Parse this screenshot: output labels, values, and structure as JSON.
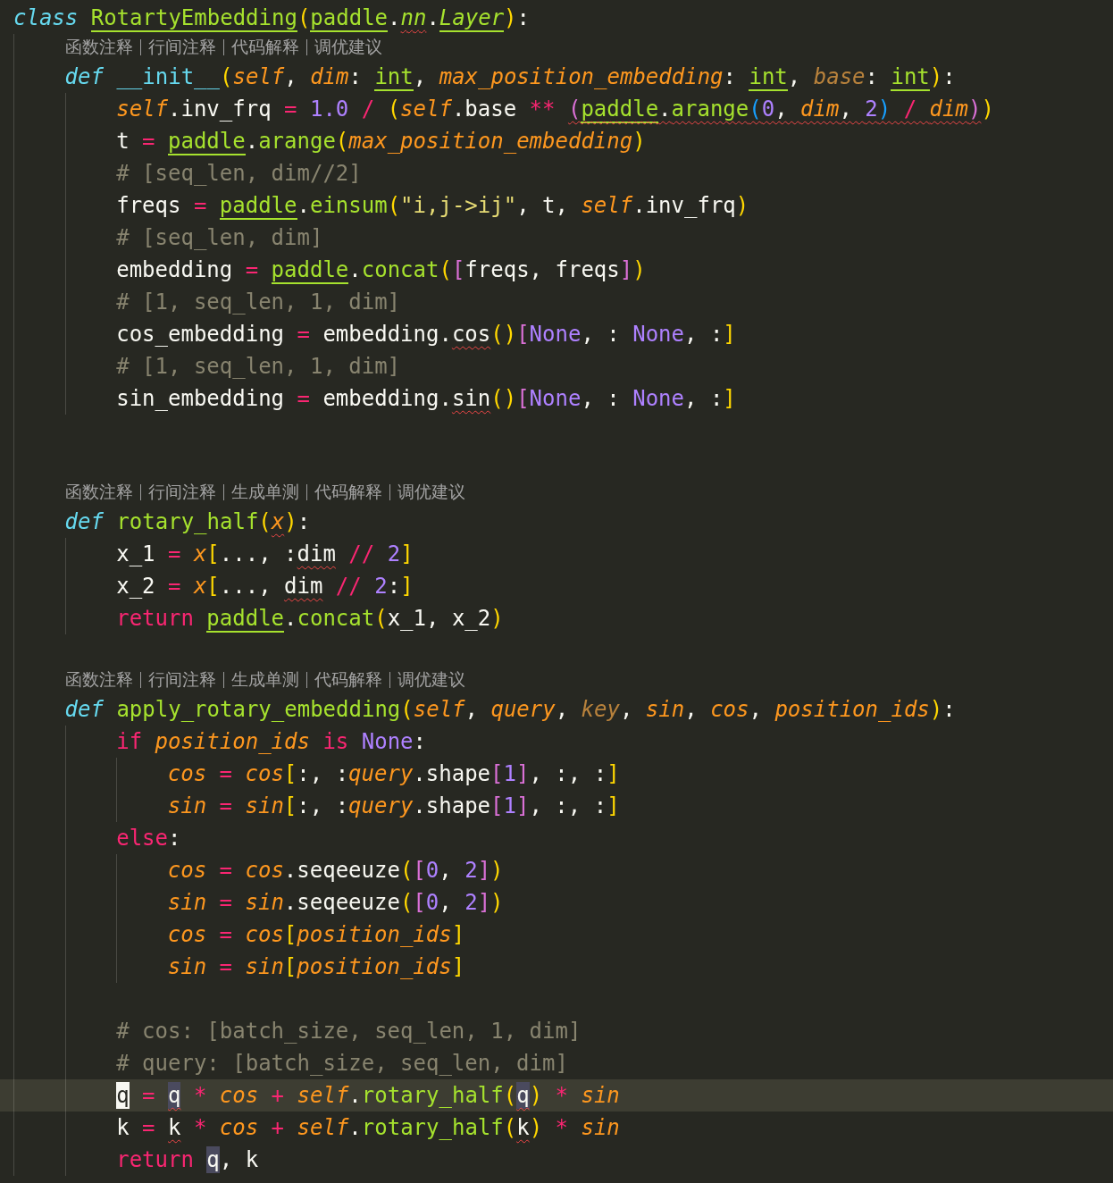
{
  "lines": [
    {
      "kind": "code",
      "current": false,
      "tokens": [
        {
          "text": "class ",
          "kind": "st"
        },
        {
          "text": "RotartyEmbedding",
          "kind": "fn",
          "underlined": true
        },
        {
          "text": "(",
          "kind": "b1"
        },
        {
          "text": "paddle",
          "kind": "fn",
          "underlined": true
        },
        {
          "text": ".",
          "kind": "tx"
        },
        {
          "text": "nn",
          "kind": "fni",
          "squiggle": true
        },
        {
          "text": ".",
          "kind": "tx"
        },
        {
          "text": "Layer",
          "kind": "fni",
          "underlined": true
        },
        {
          "text": ")",
          "kind": "b1"
        },
        {
          "text": ":",
          "kind": "tx"
        }
      ],
      "children": [
        {
          "kind": "lens",
          "items": [
            "函数注释",
            "行间注释",
            "代码解释",
            "调优建议"
          ]
        },
        {
          "kind": "code",
          "current": false,
          "tokens": [
            {
              "text": "def ",
              "kind": "st"
            },
            {
              "text": "__init__",
              "kind": "dn"
            },
            {
              "text": "(",
              "kind": "b1"
            },
            {
              "text": "self",
              "kind": "pa"
            },
            {
              "text": ", ",
              "kind": "tx"
            },
            {
              "text": "dim",
              "kind": "pa"
            },
            {
              "text": ": ",
              "kind": "tx"
            },
            {
              "text": "int",
              "kind": "fn",
              "underlined": true
            },
            {
              "text": ", ",
              "kind": "tx"
            },
            {
              "text": "max_position_embedding",
              "kind": "pa"
            },
            {
              "text": ": ",
              "kind": "tx"
            },
            {
              "text": "int",
              "kind": "fn",
              "underlined": true
            },
            {
              "text": ", ",
              "kind": "tx"
            },
            {
              "text": "base",
              "kind": "pad"
            },
            {
              "text": ": ",
              "kind": "tx"
            },
            {
              "text": "int",
              "kind": "fn",
              "underlined": true
            },
            {
              "text": ")",
              "kind": "b1"
            },
            {
              "text": ":",
              "kind": "tx"
            }
          ],
          "children": [
            {
              "kind": "code",
              "current": false,
              "tokens": [
                {
                  "text": "self",
                  "kind": "pa"
                },
                {
                  "text": ".inv_frq",
                  "kind": "tx"
                },
                {
                  "text": " = ",
                  "kind": "op"
                },
                {
                  "text": "1.0",
                  "kind": "nu"
                },
                {
                  "text": " / ",
                  "kind": "op"
                },
                {
                  "text": "(",
                  "kind": "b1"
                },
                {
                  "text": "self",
                  "kind": "pa"
                },
                {
                  "text": ".base",
                  "kind": "tx"
                },
                {
                  "text": " ** ",
                  "kind": "op"
                },
                {
                  "text": "(",
                  "kind": "b2",
                  "squiggle": true
                },
                {
                  "text": "paddle",
                  "kind": "fn",
                  "underlined": true,
                  "squiggle": true
                },
                {
                  "text": ".",
                  "kind": "tx",
                  "squiggle": true
                },
                {
                  "text": "arange",
                  "kind": "fn",
                  "squiggle": true
                },
                {
                  "text": "(",
                  "kind": "b3",
                  "squiggle": true
                },
                {
                  "text": "0",
                  "kind": "nu",
                  "squiggle": true
                },
                {
                  "text": ", ",
                  "kind": "tx",
                  "squiggle": true
                },
                {
                  "text": "dim",
                  "kind": "pa",
                  "squiggle": true
                },
                {
                  "text": ", ",
                  "kind": "tx",
                  "squiggle": true
                },
                {
                  "text": "2",
                  "kind": "nu",
                  "squiggle": true
                },
                {
                  "text": ")",
                  "kind": "b3",
                  "squiggle": true
                },
                {
                  "text": " / ",
                  "kind": "op",
                  "squiggle": true
                },
                {
                  "text": "dim",
                  "kind": "pa",
                  "squiggle": true
                },
                {
                  "text": ")",
                  "kind": "b2",
                  "squiggle": true
                },
                {
                  "text": ")",
                  "kind": "b1"
                }
              ]
            },
            {
              "kind": "code",
              "current": false,
              "tokens": [
                {
                  "text": "t",
                  "kind": "tx"
                },
                {
                  "text": " = ",
                  "kind": "op"
                },
                {
                  "text": "paddle",
                  "kind": "fn",
                  "underlined": true
                },
                {
                  "text": ".",
                  "kind": "tx"
                },
                {
                  "text": "arange",
                  "kind": "fn"
                },
                {
                  "text": "(",
                  "kind": "b1"
                },
                {
                  "text": "max_position_embedding",
                  "kind": "pa"
                },
                {
                  "text": ")",
                  "kind": "b1"
                }
              ]
            },
            {
              "kind": "code",
              "current": false,
              "tokens": [
                {
                  "text": "# [seq_len, dim//2]",
                  "kind": "cm"
                }
              ]
            },
            {
              "kind": "code",
              "current": false,
              "tokens": [
                {
                  "text": "freqs",
                  "kind": "tx"
                },
                {
                  "text": " = ",
                  "kind": "op"
                },
                {
                  "text": "paddle",
                  "kind": "fn",
                  "underlined": true
                },
                {
                  "text": ".",
                  "kind": "tx"
                },
                {
                  "text": "einsum",
                  "kind": "fn"
                },
                {
                  "text": "(",
                  "kind": "b1"
                },
                {
                  "text": "\"i,j->ij\"",
                  "kind": "str"
                },
                {
                  "text": ", t, ",
                  "kind": "tx"
                },
                {
                  "text": "self",
                  "kind": "pa"
                },
                {
                  "text": ".inv_frq",
                  "kind": "tx"
                },
                {
                  "text": ")",
                  "kind": "b1"
                }
              ]
            },
            {
              "kind": "code",
              "current": false,
              "tokens": [
                {
                  "text": "# [seq_len, dim]",
                  "kind": "cm"
                }
              ]
            },
            {
              "kind": "code",
              "current": false,
              "tokens": [
                {
                  "text": "embedding",
                  "kind": "tx"
                },
                {
                  "text": " = ",
                  "kind": "op"
                },
                {
                  "text": "paddle",
                  "kind": "fn",
                  "underlined": true
                },
                {
                  "text": ".",
                  "kind": "tx"
                },
                {
                  "text": "concat",
                  "kind": "fn"
                },
                {
                  "text": "(",
                  "kind": "b1"
                },
                {
                  "text": "[",
                  "kind": "b2"
                },
                {
                  "text": "freqs, freqs",
                  "kind": "tx"
                },
                {
                  "text": "]",
                  "kind": "b2"
                },
                {
                  "text": ")",
                  "kind": "b1"
                }
              ]
            },
            {
              "kind": "code",
              "current": false,
              "tokens": [
                {
                  "text": "# [1, seq_len, 1, dim]",
                  "kind": "cm"
                }
              ]
            },
            {
              "kind": "code",
              "current": false,
              "tokens": [
                {
                  "text": "cos_embedding",
                  "kind": "tx"
                },
                {
                  "text": " = ",
                  "kind": "op"
                },
                {
                  "text": "embedding.",
                  "kind": "tx"
                },
                {
                  "text": "cos",
                  "kind": "tx",
                  "squiggle": true
                },
                {
                  "text": "()",
                  "kind": "b1"
                },
                {
                  "text": "[",
                  "kind": "b2"
                },
                {
                  "text": "None",
                  "kind": "nu"
                },
                {
                  "text": ", : ",
                  "kind": "tx"
                },
                {
                  "text": "None",
                  "kind": "nu"
                },
                {
                  "text": ", :",
                  "kind": "tx"
                },
                {
                  "text": "]",
                  "kind": "b1"
                }
              ]
            },
            {
              "kind": "code",
              "current": false,
              "tokens": [
                {
                  "text": "# [1, seq_len, 1, dim]",
                  "kind": "cm"
                }
              ]
            },
            {
              "kind": "code",
              "current": false,
              "tokens": [
                {
                  "text": "sin_embedding",
                  "kind": "tx"
                },
                {
                  "text": " = ",
                  "kind": "op"
                },
                {
                  "text": "embedding.",
                  "kind": "tx"
                },
                {
                  "text": "sin",
                  "kind": "tx",
                  "squiggle": true
                },
                {
                  "text": "()",
                  "kind": "b1"
                },
                {
                  "text": "[",
                  "kind": "b2"
                },
                {
                  "text": "None",
                  "kind": "nu"
                },
                {
                  "text": ", : ",
                  "kind": "tx"
                },
                {
                  "text": "None",
                  "kind": "nu"
                },
                {
                  "text": ", :",
                  "kind": "tx"
                },
                {
                  "text": "]",
                  "kind": "b1"
                }
              ]
            }
          ]
        },
        {
          "kind": "blank"
        },
        {
          "kind": "blank"
        },
        {
          "kind": "lens",
          "items": [
            "函数注释",
            "行间注释",
            "生成单测",
            "代码解释",
            "调优建议"
          ]
        },
        {
          "kind": "code",
          "current": false,
          "tokens": [
            {
              "text": "def ",
              "kind": "st"
            },
            {
              "text": "rotary_half",
              "kind": "fn"
            },
            {
              "text": "(",
              "kind": "b1"
            },
            {
              "text": "x",
              "kind": "pa",
              "squiggle": true
            },
            {
              "text": ")",
              "kind": "b1"
            },
            {
              "text": ":",
              "kind": "tx"
            }
          ],
          "children": [
            {
              "kind": "code",
              "current": false,
              "tokens": [
                {
                  "text": "x_1",
                  "kind": "tx"
                },
                {
                  "text": " = ",
                  "kind": "op"
                },
                {
                  "text": "x",
                  "kind": "pa"
                },
                {
                  "text": "[",
                  "kind": "b1"
                },
                {
                  "text": "..., :",
                  "kind": "tx"
                },
                {
                  "text": "dim",
                  "kind": "tx",
                  "squiggle": true
                },
                {
                  "text": " // ",
                  "kind": "op"
                },
                {
                  "text": "2",
                  "kind": "nu"
                },
                {
                  "text": "]",
                  "kind": "b1"
                }
              ]
            },
            {
              "kind": "code",
              "current": false,
              "tokens": [
                {
                  "text": "x_2",
                  "kind": "tx"
                },
                {
                  "text": " = ",
                  "kind": "op"
                },
                {
                  "text": "x",
                  "kind": "pa"
                },
                {
                  "text": "[",
                  "kind": "b1"
                },
                {
                  "text": "..., ",
                  "kind": "tx"
                },
                {
                  "text": "dim",
                  "kind": "tx",
                  "squiggle": true
                },
                {
                  "text": " // ",
                  "kind": "op"
                },
                {
                  "text": "2",
                  "kind": "nu"
                },
                {
                  "text": ":",
                  "kind": "tx"
                },
                {
                  "text": "]",
                  "kind": "b1"
                }
              ]
            },
            {
              "kind": "code",
              "current": false,
              "tokens": [
                {
                  "text": "return ",
                  "kind": "op"
                },
                {
                  "text": "paddle",
                  "kind": "fn",
                  "underlined": true
                },
                {
                  "text": ".",
                  "kind": "tx"
                },
                {
                  "text": "concat",
                  "kind": "fn"
                },
                {
                  "text": "(",
                  "kind": "b1"
                },
                {
                  "text": "x_1, x_2",
                  "kind": "tx"
                },
                {
                  "text": ")",
                  "kind": "b1"
                }
              ]
            }
          ]
        },
        {
          "kind": "blank"
        },
        {
          "kind": "lens",
          "items": [
            "函数注释",
            "行间注释",
            "生成单测",
            "代码解释",
            "调优建议"
          ]
        },
        {
          "kind": "code",
          "current": false,
          "tokens": [
            {
              "text": "def ",
              "kind": "st"
            },
            {
              "text": "apply_rotary_embedding",
              "kind": "fn"
            },
            {
              "text": "(",
              "kind": "b1"
            },
            {
              "text": "self",
              "kind": "pa"
            },
            {
              "text": ", ",
              "kind": "tx"
            },
            {
              "text": "query",
              "kind": "pa"
            },
            {
              "text": ", ",
              "kind": "tx"
            },
            {
              "text": "key",
              "kind": "pad"
            },
            {
              "text": ", ",
              "kind": "tx"
            },
            {
              "text": "sin",
              "kind": "pa"
            },
            {
              "text": ", ",
              "kind": "tx"
            },
            {
              "text": "cos",
              "kind": "pa"
            },
            {
              "text": ", ",
              "kind": "tx"
            },
            {
              "text": "position_ids",
              "kind": "pa"
            },
            {
              "text": ")",
              "kind": "b1"
            },
            {
              "text": ":",
              "kind": "tx"
            }
          ],
          "children": [
            {
              "kind": "code",
              "current": false,
              "tokens": [
                {
                  "text": "if ",
                  "kind": "op"
                },
                {
                  "text": "position_ids",
                  "kind": "pa"
                },
                {
                  "text": " is ",
                  "kind": "op"
                },
                {
                  "text": "None",
                  "kind": "nu"
                },
                {
                  "text": ":",
                  "kind": "tx"
                }
              ],
              "children": [
                {
                  "kind": "code",
                  "current": false,
                  "tokens": [
                    {
                      "text": "cos",
                      "kind": "pa"
                    },
                    {
                      "text": " = ",
                      "kind": "op"
                    },
                    {
                      "text": "cos",
                      "kind": "pa"
                    },
                    {
                      "text": "[",
                      "kind": "b1"
                    },
                    {
                      "text": ":, :",
                      "kind": "tx"
                    },
                    {
                      "text": "query",
                      "kind": "pa"
                    },
                    {
                      "text": ".shape",
                      "kind": "tx"
                    },
                    {
                      "text": "[",
                      "kind": "b2"
                    },
                    {
                      "text": "1",
                      "kind": "nu"
                    },
                    {
                      "text": "]",
                      "kind": "b2"
                    },
                    {
                      "text": ", :, :",
                      "kind": "tx"
                    },
                    {
                      "text": "]",
                      "kind": "b1"
                    }
                  ]
                },
                {
                  "kind": "code",
                  "current": false,
                  "tokens": [
                    {
                      "text": "sin",
                      "kind": "pa"
                    },
                    {
                      "text": " = ",
                      "kind": "op"
                    },
                    {
                      "text": "sin",
                      "kind": "pa"
                    },
                    {
                      "text": "[",
                      "kind": "b1"
                    },
                    {
                      "text": ":, :",
                      "kind": "tx"
                    },
                    {
                      "text": "query",
                      "kind": "pa"
                    },
                    {
                      "text": ".shape",
                      "kind": "tx"
                    },
                    {
                      "text": "[",
                      "kind": "b2"
                    },
                    {
                      "text": "1",
                      "kind": "nu"
                    },
                    {
                      "text": "]",
                      "kind": "b2"
                    },
                    {
                      "text": ", :, :",
                      "kind": "tx"
                    },
                    {
                      "text": "]",
                      "kind": "b1"
                    }
                  ]
                }
              ]
            },
            {
              "kind": "code",
              "current": false,
              "tokens": [
                {
                  "text": "else",
                  "kind": "op"
                },
                {
                  "text": ":",
                  "kind": "tx"
                }
              ],
              "children": [
                {
                  "kind": "code",
                  "current": false,
                  "tokens": [
                    {
                      "text": "cos",
                      "kind": "pa"
                    },
                    {
                      "text": " = ",
                      "kind": "op"
                    },
                    {
                      "text": "cos",
                      "kind": "pa"
                    },
                    {
                      "text": ".seqeeuze",
                      "kind": "tx"
                    },
                    {
                      "text": "(",
                      "kind": "b1"
                    },
                    {
                      "text": "[",
                      "kind": "b2"
                    },
                    {
                      "text": "0",
                      "kind": "nu"
                    },
                    {
                      "text": ", ",
                      "kind": "tx"
                    },
                    {
                      "text": "2",
                      "kind": "nu"
                    },
                    {
                      "text": "]",
                      "kind": "b2"
                    },
                    {
                      "text": ")",
                      "kind": "b1"
                    }
                  ]
                },
                {
                  "kind": "code",
                  "current": false,
                  "tokens": [
                    {
                      "text": "sin",
                      "kind": "pa"
                    },
                    {
                      "text": " = ",
                      "kind": "op"
                    },
                    {
                      "text": "sin",
                      "kind": "pa"
                    },
                    {
                      "text": ".seqeeuze",
                      "kind": "tx"
                    },
                    {
                      "text": "(",
                      "kind": "b1"
                    },
                    {
                      "text": "[",
                      "kind": "b2"
                    },
                    {
                      "text": "0",
                      "kind": "nu"
                    },
                    {
                      "text": ", ",
                      "kind": "tx"
                    },
                    {
                      "text": "2",
                      "kind": "nu"
                    },
                    {
                      "text": "]",
                      "kind": "b2"
                    },
                    {
                      "text": ")",
                      "kind": "b1"
                    }
                  ]
                },
                {
                  "kind": "code",
                  "current": false,
                  "tokens": [
                    {
                      "text": "cos",
                      "kind": "pa"
                    },
                    {
                      "text": " = ",
                      "kind": "op"
                    },
                    {
                      "text": "cos",
                      "kind": "pa"
                    },
                    {
                      "text": "[",
                      "kind": "b1"
                    },
                    {
                      "text": "position_ids",
                      "kind": "pa"
                    },
                    {
                      "text": "]",
                      "kind": "b1"
                    }
                  ]
                },
                {
                  "kind": "code",
                  "current": false,
                  "tokens": [
                    {
                      "text": "sin",
                      "kind": "pa"
                    },
                    {
                      "text": " = ",
                      "kind": "op"
                    },
                    {
                      "text": "sin",
                      "kind": "pa"
                    },
                    {
                      "text": "[",
                      "kind": "b1"
                    },
                    {
                      "text": "position_ids",
                      "kind": "pa"
                    },
                    {
                      "text": "]",
                      "kind": "b1"
                    }
                  ]
                }
              ]
            },
            {
              "kind": "blank"
            },
            {
              "kind": "code",
              "current": false,
              "tokens": [
                {
                  "text": "# cos: [batch_size, seq_len, 1, dim]",
                  "kind": "cm"
                }
              ]
            },
            {
              "kind": "code",
              "current": false,
              "tokens": [
                {
                  "text": "# query: [batch_size, seq_len, dim]",
                  "kind": "cm"
                }
              ]
            },
            {
              "kind": "code",
              "current": true,
              "tokens": [
                {
                  "text": "q",
                  "kind": "tx",
                  "cursor": true
                },
                {
                  "text": " = ",
                  "kind": "op"
                },
                {
                  "text": "q",
                  "kind": "tx",
                  "highlighted": true,
                  "squiggle": true
                },
                {
                  "text": " * ",
                  "kind": "op"
                },
                {
                  "text": "cos",
                  "kind": "pa"
                },
                {
                  "text": " + ",
                  "kind": "op"
                },
                {
                  "text": "self",
                  "kind": "pa"
                },
                {
                  "text": ".",
                  "kind": "tx"
                },
                {
                  "text": "rotary_half",
                  "kind": "fn"
                },
                {
                  "text": "(",
                  "kind": "b1"
                },
                {
                  "text": "q",
                  "kind": "tx",
                  "highlighted": true,
                  "squiggle": true
                },
                {
                  "text": ")",
                  "kind": "b1"
                },
                {
                  "text": " * ",
                  "kind": "op"
                },
                {
                  "text": "sin",
                  "kind": "pa"
                }
              ]
            },
            {
              "kind": "code",
              "current": false,
              "tokens": [
                {
                  "text": "k",
                  "kind": "tx"
                },
                {
                  "text": " = ",
                  "kind": "op"
                },
                {
                  "text": "k",
                  "kind": "tx",
                  "squiggle": true
                },
                {
                  "text": " * ",
                  "kind": "op"
                },
                {
                  "text": "cos",
                  "kind": "pa"
                },
                {
                  "text": " + ",
                  "kind": "op"
                },
                {
                  "text": "self",
                  "kind": "pa"
                },
                {
                  "text": ".",
                  "kind": "tx"
                },
                {
                  "text": "rotary_half",
                  "kind": "fn"
                },
                {
                  "text": "(",
                  "kind": "b1"
                },
                {
                  "text": "k",
                  "kind": "tx",
                  "squiggle": true
                },
                {
                  "text": ")",
                  "kind": "b1"
                },
                {
                  "text": " * ",
                  "kind": "op"
                },
                {
                  "text": "sin",
                  "kind": "pa"
                }
              ]
            },
            {
              "kind": "code",
              "current": false,
              "tokens": [
                {
                  "text": "return ",
                  "kind": "op"
                },
                {
                  "text": "q",
                  "kind": "tx",
                  "highlighted": true
                },
                {
                  "text": ", k",
                  "kind": "tx"
                }
              ]
            }
          ]
        }
      ]
    }
  ]
}
